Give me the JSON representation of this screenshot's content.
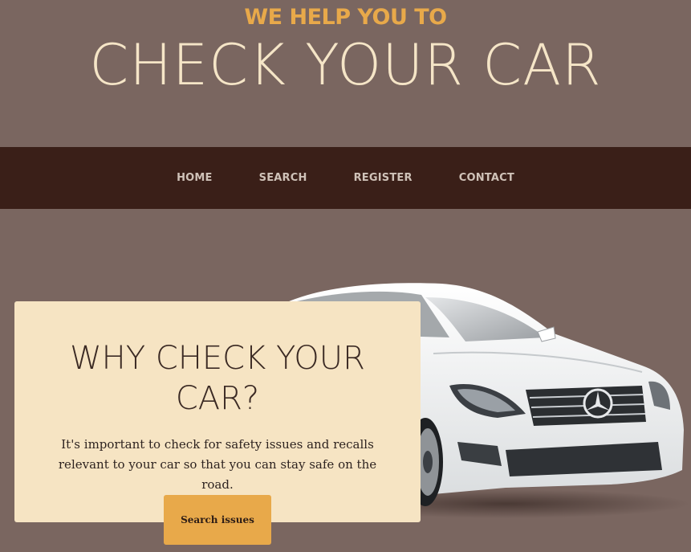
{
  "hero": {
    "subtitle": "WE HELP YOU TO",
    "title": "CHECK YOUR CAR"
  },
  "nav": {
    "items": [
      {
        "label": "HOME"
      },
      {
        "label": "SEARCH"
      },
      {
        "label": "REGISTER"
      },
      {
        "label": "CONTACT"
      }
    ]
  },
  "feature": {
    "title": "WHY CHECK YOUR CAR?",
    "body": "It's important to check for safety issues and recalls relevant to your car so that you can stay safe on the road.",
    "button_label": "Search issues"
  },
  "colors": {
    "background": "#7a6660",
    "nav_background": "#3a1f18",
    "accent": "#e8a94a",
    "card_background": "#f6e4c3",
    "title_text": "#f5e5c7"
  },
  "image": {
    "name": "white-car-icon"
  }
}
